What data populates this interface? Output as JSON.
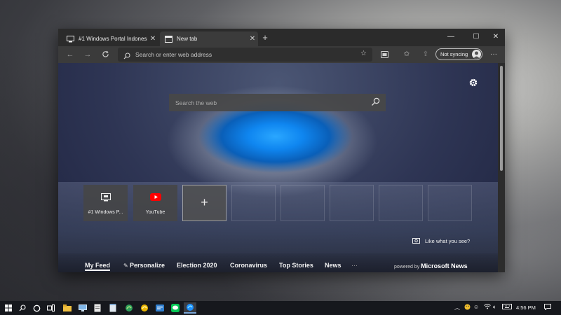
{
  "browser": {
    "tabs": [
      {
        "title": "#1 Windows Portal Indonesia",
        "active": false
      },
      {
        "title": "New tab",
        "active": true
      }
    ],
    "address_placeholder": "Search or enter web address",
    "sync_label": "Not syncing"
  },
  "newtab": {
    "search_placeholder": "Search the web",
    "tiles": [
      {
        "label": "#1 Windows P...",
        "icon": "monitor-icon"
      },
      {
        "label": "YouTube",
        "icon": "youtube-icon"
      }
    ],
    "like_label": "Like what you see?",
    "feed_tabs": [
      "My Feed",
      "Personalize",
      "Election 2020",
      "Coronavirus",
      "Top Stories",
      "News"
    ],
    "more": "···",
    "powered_prefix": "powered by",
    "powered_brand": "Microsoft News"
  },
  "taskbar": {
    "clock": "4:56 PM"
  },
  "colors": {
    "accent_blue": "#1e90ff",
    "youtube_red": "#ff0000"
  }
}
